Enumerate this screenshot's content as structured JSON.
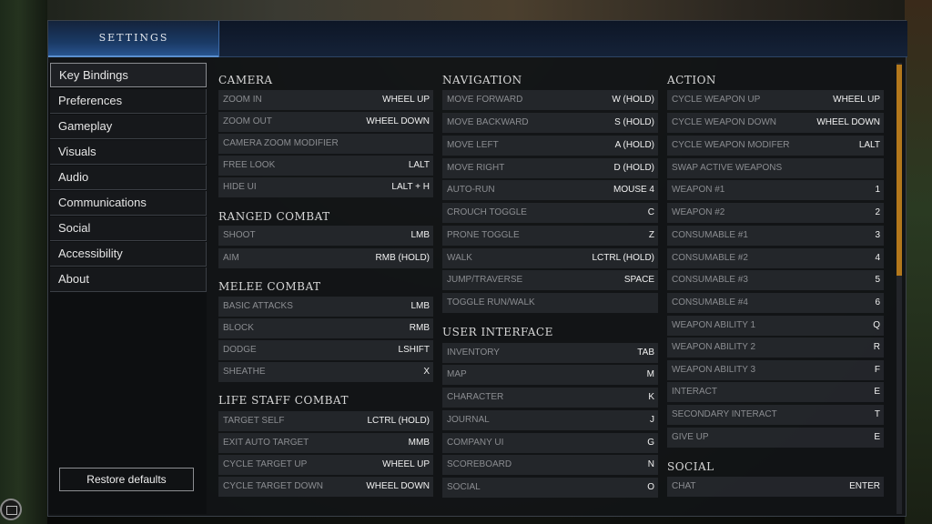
{
  "window": {
    "title": "SETTINGS"
  },
  "sidebar": {
    "items": [
      {
        "label": "Key Bindings"
      },
      {
        "label": "Preferences"
      },
      {
        "label": "Gameplay"
      },
      {
        "label": "Visuals"
      },
      {
        "label": "Audio"
      },
      {
        "label": "Communications"
      },
      {
        "label": "Social"
      },
      {
        "label": "Accessibility"
      },
      {
        "label": "About"
      }
    ],
    "active_index": 0,
    "restore_label": "Restore defaults"
  },
  "sections": {
    "camera": {
      "title": "CAMERA",
      "rows": [
        {
          "action": "ZOOM IN",
          "key": "WHEEL UP"
        },
        {
          "action": "ZOOM OUT",
          "key": "WHEEL DOWN"
        },
        {
          "action": "CAMERA ZOOM MODIFIER",
          "key": ""
        },
        {
          "action": "FREE LOOK",
          "key": "LALT"
        },
        {
          "action": "HIDE UI",
          "key": "LALT + H"
        }
      ]
    },
    "ranged": {
      "title": "RANGED COMBAT",
      "rows": [
        {
          "action": "SHOOT",
          "key": "LMB"
        },
        {
          "action": "AIM",
          "key": "RMB (HOLD)"
        }
      ]
    },
    "melee": {
      "title": "MELEE COMBAT",
      "rows": [
        {
          "action": "BASIC ATTACKS",
          "key": "LMB"
        },
        {
          "action": "BLOCK",
          "key": "RMB"
        },
        {
          "action": "DODGE",
          "key": "LSHIFT"
        },
        {
          "action": "SHEATHE",
          "key": "X"
        }
      ]
    },
    "lifestaff": {
      "title": "LIFE STAFF COMBAT",
      "rows": [
        {
          "action": "TARGET SELF",
          "key": "LCTRL (HOLD)"
        },
        {
          "action": "EXIT AUTO TARGET",
          "key": "MMB"
        },
        {
          "action": "CYCLE TARGET UP",
          "key": "WHEEL UP"
        },
        {
          "action": "CYCLE TARGET DOWN",
          "key": "WHEEL DOWN"
        }
      ]
    },
    "navigation": {
      "title": "NAVIGATION",
      "rows": [
        {
          "action": "MOVE FORWARD",
          "key": "W (HOLD)"
        },
        {
          "action": "MOVE BACKWARD",
          "key": "S (HOLD)"
        },
        {
          "action": "MOVE LEFT",
          "key": "A (HOLD)"
        },
        {
          "action": "MOVE RIGHT",
          "key": "D (HOLD)"
        },
        {
          "action": "AUTO-RUN",
          "key": "MOUSE 4"
        },
        {
          "action": "CROUCH TOGGLE",
          "key": "C"
        },
        {
          "action": "PRONE TOGGLE",
          "key": "Z"
        },
        {
          "action": "WALK",
          "key": "LCTRL (HOLD)"
        },
        {
          "action": "JUMP/TRAVERSE",
          "key": "SPACE"
        },
        {
          "action": "TOGGLE RUN/WALK",
          "key": ""
        }
      ]
    },
    "ui": {
      "title": "USER INTERFACE",
      "rows": [
        {
          "action": "INVENTORY",
          "key": "TAB"
        },
        {
          "action": "MAP",
          "key": "M"
        },
        {
          "action": "CHARACTER",
          "key": "K"
        },
        {
          "action": "JOURNAL",
          "key": "J"
        },
        {
          "action": "COMPANY UI",
          "key": "G"
        },
        {
          "action": "SCOREBOARD",
          "key": "N"
        },
        {
          "action": "SOCIAL",
          "key": "O"
        }
      ]
    },
    "action": {
      "title": "ACTION",
      "rows": [
        {
          "action": "CYCLE WEAPON UP",
          "key": "WHEEL UP"
        },
        {
          "action": "CYCLE WEAPON DOWN",
          "key": "WHEEL DOWN"
        },
        {
          "action": "CYCLE WEAPON MODIFER",
          "key": "LALT"
        },
        {
          "action": "SWAP ACTIVE WEAPONS",
          "key": ""
        },
        {
          "action": "WEAPON #1",
          "key": "1"
        },
        {
          "action": "WEAPON #2",
          "key": "2"
        },
        {
          "action": "CONSUMABLE #1",
          "key": "3"
        },
        {
          "action": "CONSUMABLE #2",
          "key": "4"
        },
        {
          "action": "CONSUMABLE #3",
          "key": "5"
        },
        {
          "action": "CONSUMABLE #4",
          "key": "6"
        },
        {
          "action": "WEAPON ABILITY 1",
          "key": "Q"
        },
        {
          "action": "WEAPON ABILITY 2",
          "key": "R"
        },
        {
          "action": "WEAPON ABILITY 3",
          "key": "F"
        },
        {
          "action": "INTERACT",
          "key": "E"
        },
        {
          "action": "SECONDARY INTERACT",
          "key": "T"
        },
        {
          "action": "GIVE UP",
          "key": "E"
        }
      ]
    },
    "social": {
      "title": "SOCIAL",
      "rows": [
        {
          "action": "CHAT",
          "key": "ENTER"
        }
      ]
    }
  },
  "colors": {
    "accent_blue": "#2a5896",
    "scroll_thumb": "#b3781c",
    "row_bg": "#26282c",
    "action_text": "#8b8d91",
    "key_text": "#f2f2f2"
  }
}
